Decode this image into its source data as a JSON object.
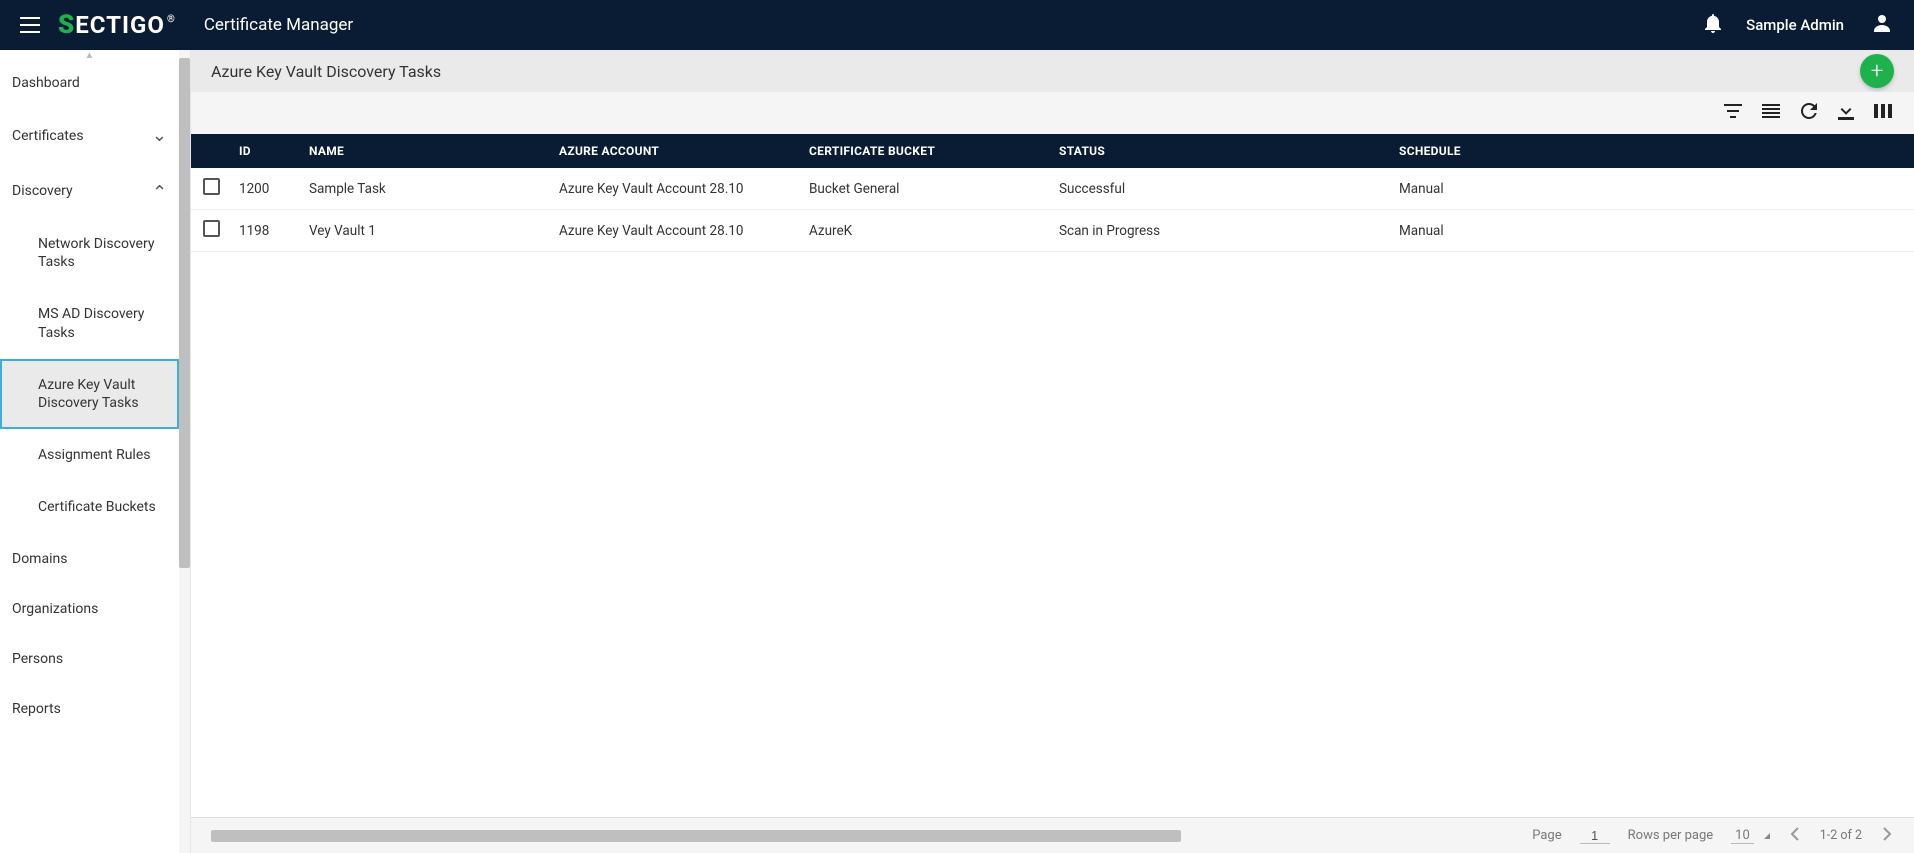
{
  "header": {
    "app_name_prefix": "S",
    "app_name_rest": "ECTIGO",
    "app_title": "Certificate Manager",
    "user_name": "Sample Admin"
  },
  "sidebar": {
    "items": [
      {
        "label": "Dashboard",
        "expandable": false
      },
      {
        "label": "Certificates",
        "expandable": true,
        "expanded": false
      },
      {
        "label": "Discovery",
        "expandable": true,
        "expanded": true
      },
      {
        "label": "Domains",
        "expandable": false
      },
      {
        "label": "Organizations",
        "expandable": false
      },
      {
        "label": "Persons",
        "expandable": false
      },
      {
        "label": "Reports",
        "expandable": false
      }
    ],
    "discovery_children": [
      {
        "label": "Network Discovery Tasks",
        "active": false
      },
      {
        "label": "MS AD Discovery Tasks",
        "active": false
      },
      {
        "label": "Azure Key Vault Discovery Tasks",
        "active": true
      },
      {
        "label": "Assignment Rules",
        "active": false
      },
      {
        "label": "Certificate Buckets",
        "active": false
      }
    ]
  },
  "page": {
    "title": "Azure Key Vault Discovery Tasks"
  },
  "table": {
    "columns": [
      "ID",
      "NAME",
      "AZURE ACCOUNT",
      "CERTIFICATE BUCKET",
      "STATUS",
      "SCHEDULE"
    ],
    "rows": [
      {
        "id": "1200",
        "name": "Sample Task",
        "account": "Azure Key Vault Account 28.10",
        "bucket": "Bucket General",
        "status": "Successful",
        "schedule": "Manual"
      },
      {
        "id": "1198",
        "name": "Vey Vault 1",
        "account": "Azure Key Vault Account 28.10",
        "bucket": "AzureK",
        "status": "Scan in Progress",
        "schedule": "Manual"
      }
    ]
  },
  "pagination": {
    "page_label": "Page",
    "page_value": "1",
    "rows_label": "Rows per page",
    "rows_value": "10",
    "range": "1-2 of 2"
  }
}
